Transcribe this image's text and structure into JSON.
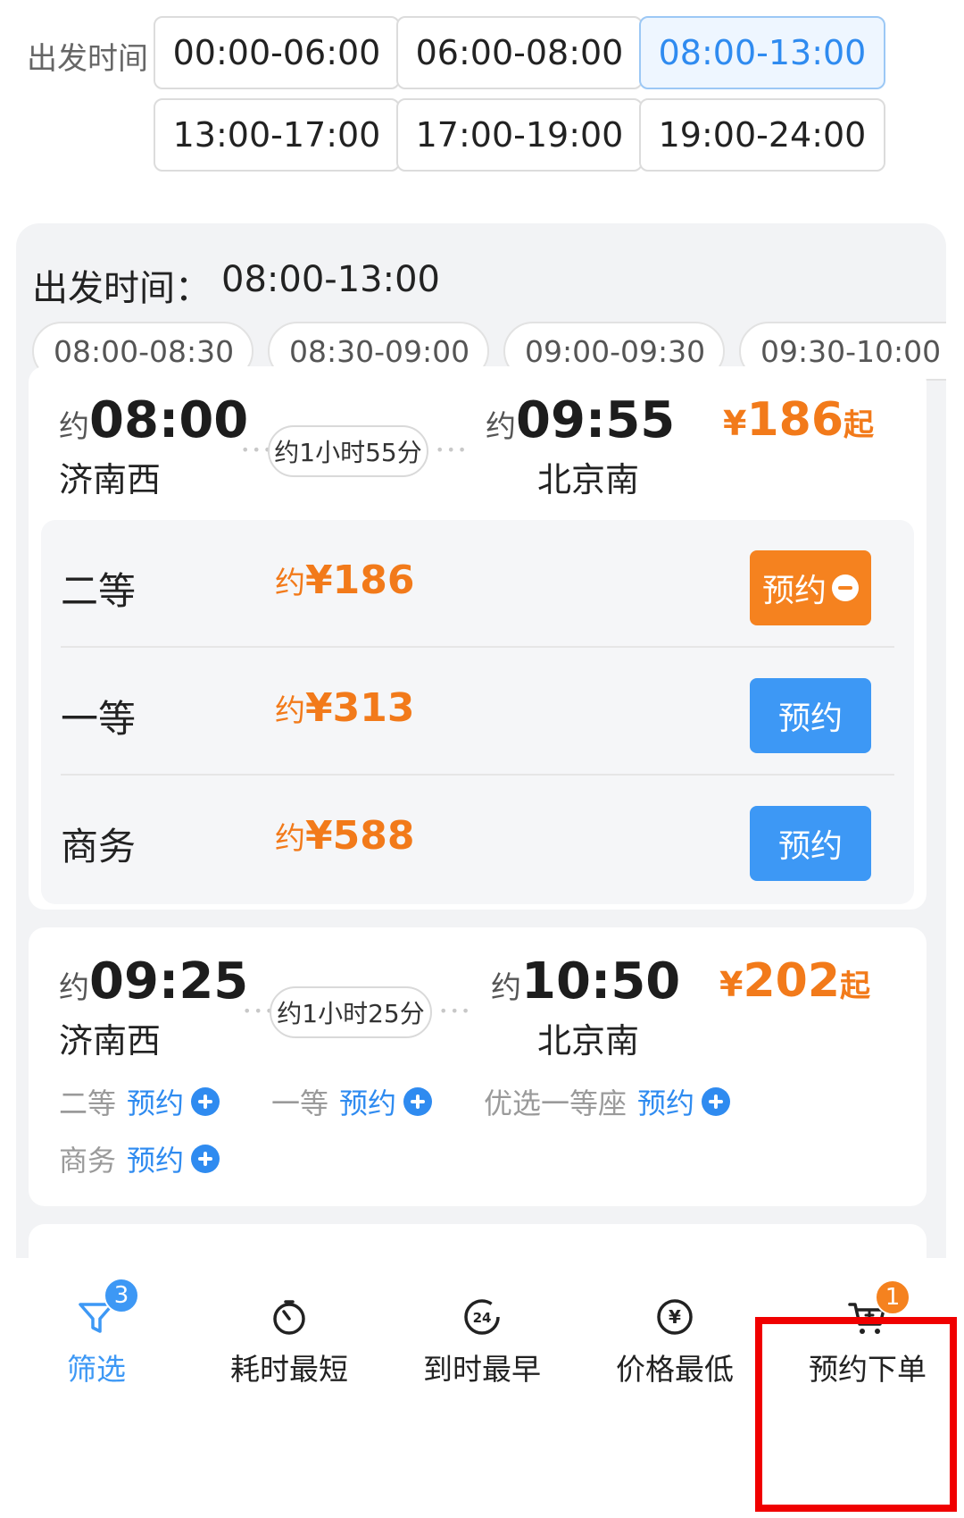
{
  "departure_filter": {
    "label": "出发时间",
    "options": [
      "00:00-06:00",
      "06:00-08:00",
      "08:00-13:00",
      "13:00-17:00",
      "17:00-19:00",
      "19:00-24:00"
    ],
    "selected": "08:00-13:00"
  },
  "panel": {
    "selected_label": "出发时间：",
    "selected_value": "08:00-13:00",
    "chips": [
      "08:00-08:30",
      "08:30-09:00",
      "09:00-09:30",
      "09:30-10:00"
    ]
  },
  "trains": [
    {
      "dep_prefix": "约",
      "dep_time": "08:00",
      "dep_station": "济南西",
      "duration": "约1小时55分",
      "arr_prefix": "约",
      "arr_time": "09:55",
      "arr_station": "北京南",
      "price_symbol": "¥",
      "price": "186",
      "price_suffix": "起",
      "seats": [
        {
          "name": "二等",
          "price_prefix": "约",
          "price": "¥186",
          "button": "预约",
          "selected": true
        },
        {
          "name": "一等",
          "price_prefix": "约",
          "price": "¥313",
          "button": "预约",
          "selected": false
        },
        {
          "name": "商务",
          "price_prefix": "约",
          "price": "¥588",
          "button": "预约",
          "selected": false
        }
      ]
    },
    {
      "dep_prefix": "约",
      "dep_time": "09:25",
      "dep_station": "济南西",
      "duration": "约1小时25分",
      "arr_prefix": "约",
      "arr_time": "10:50",
      "arr_station": "北京南",
      "price_symbol": "¥",
      "price": "202",
      "price_suffix": "起",
      "seats": [
        {
          "name": "二等",
          "button": "预约"
        },
        {
          "name": "一等",
          "button": "预约"
        },
        {
          "name": "优选一等座",
          "button": "预约"
        },
        {
          "name": "商务",
          "button": "预约"
        }
      ]
    }
  ],
  "tabbar": {
    "items": [
      {
        "label": "筛选",
        "icon": "filter-icon",
        "badge": "3"
      },
      {
        "label": "耗时最短",
        "icon": "timer-icon"
      },
      {
        "label": "到时最早",
        "icon": "clock-24-icon",
        "icon_text": "24"
      },
      {
        "label": "价格最低",
        "icon": "yen-icon",
        "icon_text": "¥"
      },
      {
        "label": "预约下单",
        "icon": "cart-icon",
        "badge": "1"
      }
    ]
  },
  "colors": {
    "accent_blue": "#3d98f5",
    "accent_orange": "#f5821f",
    "highlight_red": "#f00000"
  }
}
